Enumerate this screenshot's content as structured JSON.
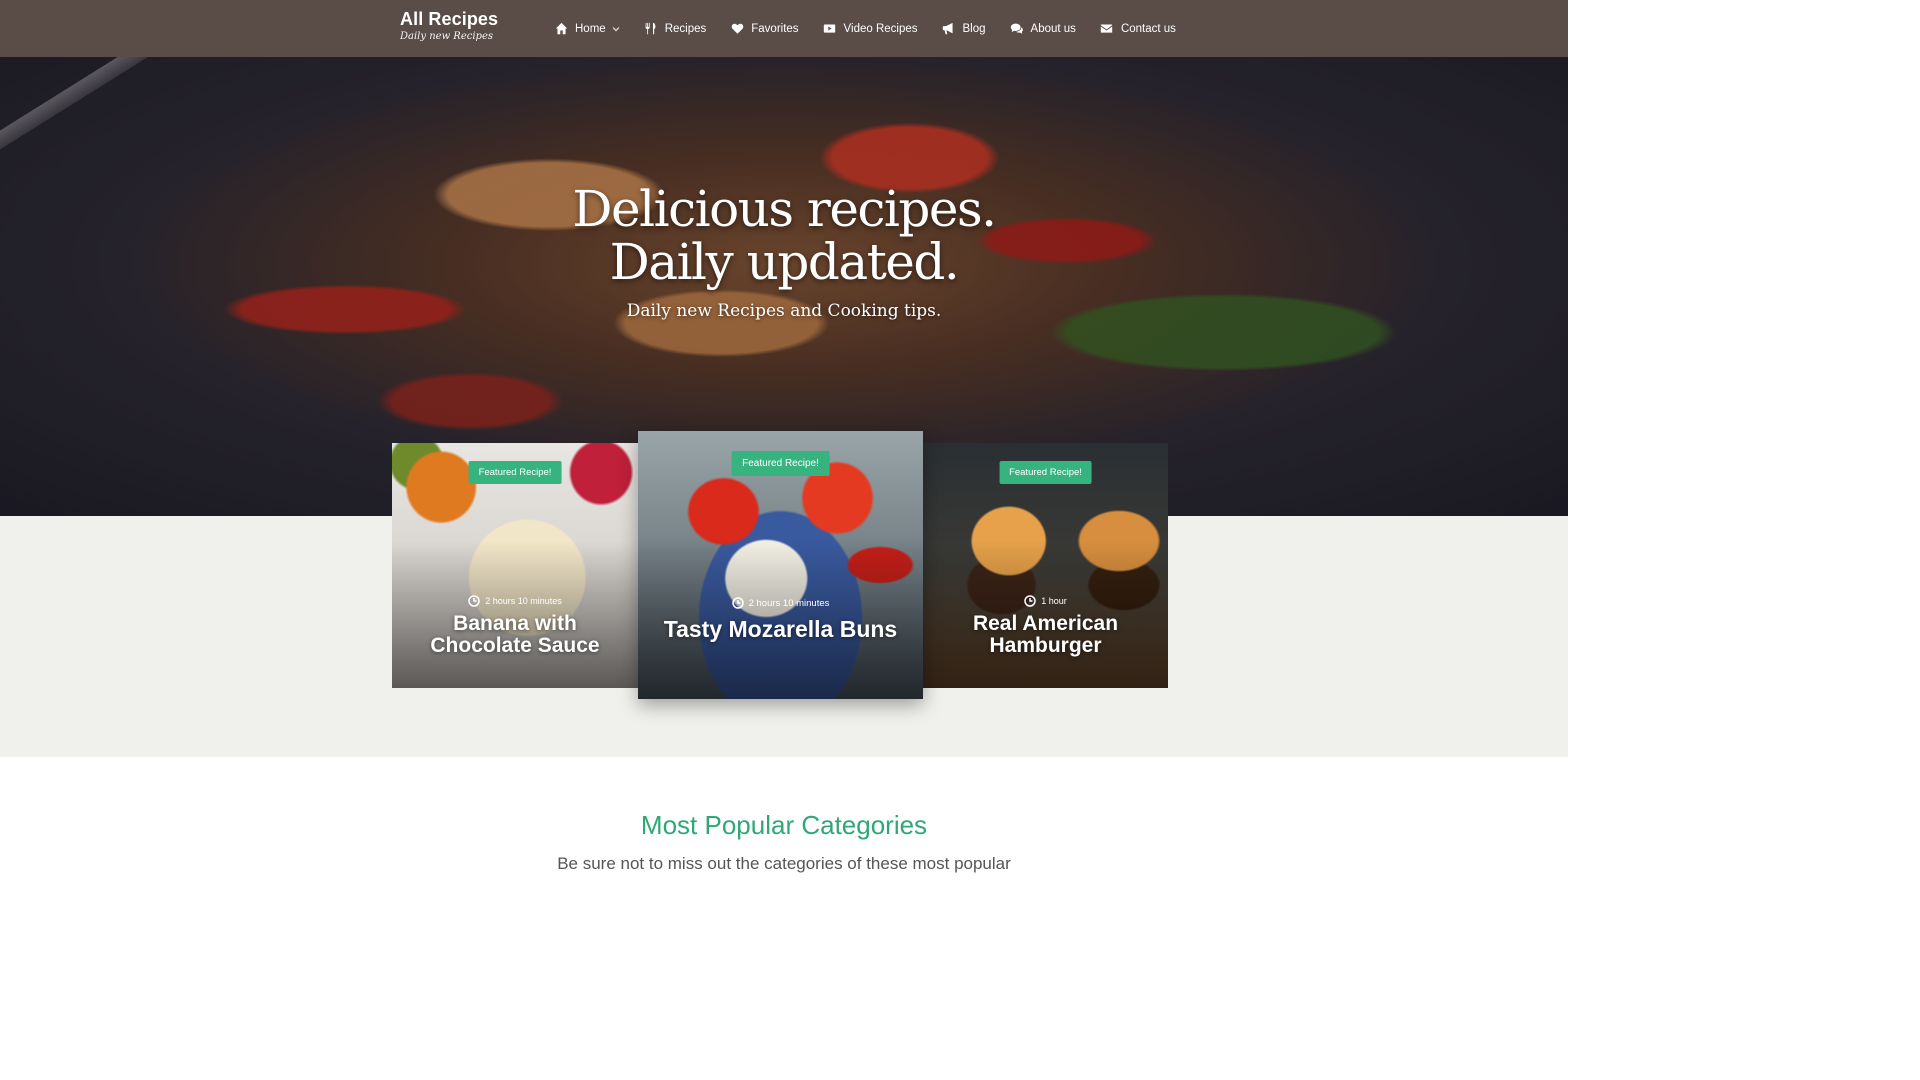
{
  "brand": {
    "name": "All Recipes",
    "tagline": "Daily new Recipes"
  },
  "nav": {
    "items": [
      {
        "label": "Home",
        "icon": "home-icon",
        "dropdown": true
      },
      {
        "label": "Recipes",
        "icon": "utensils-icon"
      },
      {
        "label": "Favorites",
        "icon": "heart-icon"
      },
      {
        "label": "Video Recipes",
        "icon": "video-icon"
      },
      {
        "label": "Blog",
        "icon": "bullhorn-icon"
      },
      {
        "label": "About us",
        "icon": "chat-icon"
      },
      {
        "label": "Contact us",
        "icon": "envelope-icon"
      }
    ]
  },
  "hero": {
    "title_line1": "Delicious recipes.",
    "title_line2": "Daily updated.",
    "subtitle": "Daily new Recipes and Cooking tips."
  },
  "featured": [
    {
      "badge": "Featured Recipe!",
      "time": "2 hours 10 minutes",
      "title": "Banana with Chocolate Sauce"
    },
    {
      "badge": "Featured Recipe!",
      "time": "2 hours 10 minutes",
      "title": "Tasty Mozarella Buns"
    },
    {
      "badge": "Featured Recipe!",
      "time": "1 hour",
      "title": "Real American Hamburger"
    }
  ],
  "categories": {
    "title": "Most Popular Categories",
    "description": "Be sure not to miss out the categories of these most popular"
  },
  "colors": {
    "header": "#5a4c47",
    "accent": "#36b37e",
    "band": "#f0f0ec"
  }
}
